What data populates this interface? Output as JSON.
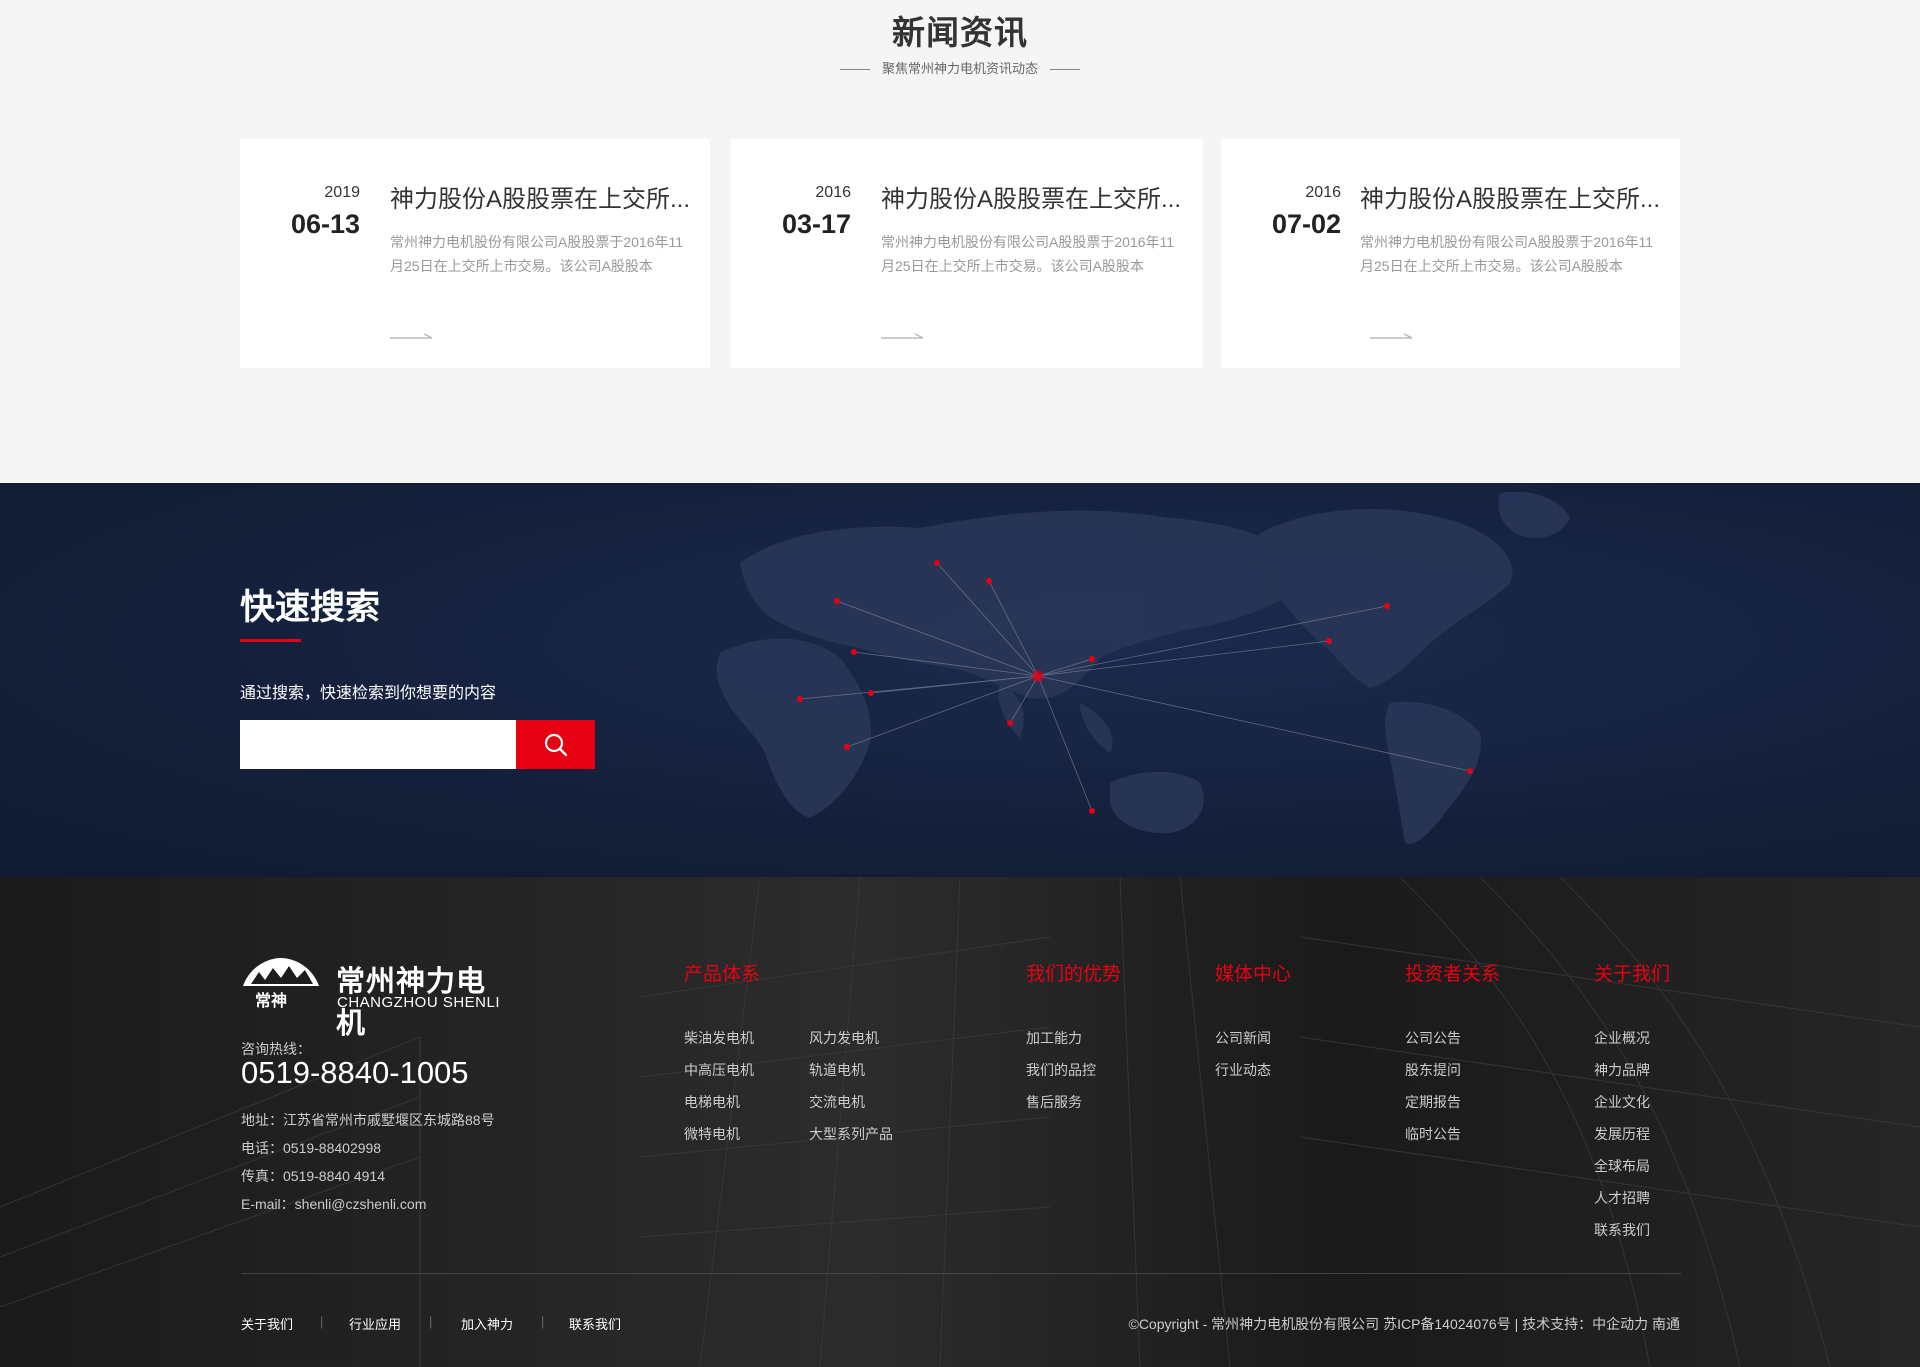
{
  "news": {
    "title": "新闻资讯",
    "subtitle": "聚焦常州神力电机资讯动态",
    "items": [
      {
        "year": "2019",
        "date": "06-13",
        "title": "神力股份A股股票在上交所...",
        "desc": "常州神力电机股份有限公司A股股票于2016年11月25日在上交所上市交易。该公司A股股本"
      },
      {
        "year": "2016",
        "date": "03-17",
        "title": "神力股份A股股票在上交所...",
        "desc": "常州神力电机股份有限公司A股股票于2016年11月25日在上交所上市交易。该公司A股股本"
      },
      {
        "year": "2016",
        "date": "07-02",
        "title": "神力股份A股股票在上交所...",
        "desc": "常州神力电机股份有限公司A股股票于2016年11月25日在上交所上市交易。该公司A股股本"
      }
    ]
  },
  "search": {
    "title": "快速搜索",
    "desc": "通过搜索，快速检索到你想要的内容",
    "placeholder": "",
    "button_icon": "search-icon",
    "accent": "#e60012"
  },
  "footer": {
    "logo": {
      "mark_text": "常神",
      "cn": "常州神力电机",
      "en": "CHANGZHOU SHENLI"
    },
    "hotline_label": "咨询热线：",
    "hotline": "0519-8840-1005",
    "address": "地址：江苏省常州市戚墅堰区东城路88号",
    "phone": "电话：0519-88402998",
    "fax": "传真：0519-8840 4914",
    "email": "E-mail：shenli@czshenli.com",
    "columns": [
      {
        "title": "产品体系",
        "links": [
          "柴油发电机",
          "风力发电机",
          "中高压电机",
          "轨道电机",
          "电梯电机",
          "交流电机",
          "微特电机",
          "大型系列产品"
        ]
      },
      {
        "title": "我们的优势",
        "links": [
          "加工能力",
          "我们的品控",
          "售后服务"
        ]
      },
      {
        "title": "媒体中心",
        "links": [
          "公司新闻",
          "行业动态"
        ]
      },
      {
        "title": "投资者关系",
        "links": [
          "公司公告",
          "股东提问",
          "定期报告",
          "临时公告"
        ]
      },
      {
        "title": "关于我们",
        "links": [
          "企业概况",
          "神力品牌",
          "企业文化",
          "发展历程",
          "全球布局",
          "人才招聘",
          "联系我们"
        ]
      }
    ],
    "bottom_links": [
      "关于我们",
      "行业应用",
      "加入神力",
      "联系我们"
    ],
    "separator": "|",
    "copyright": "©Copyright - 常州神力电机股份有限公司  苏ICP备14024076号  |  技术支持：中企动力  南通"
  },
  "colors": {
    "accent": "#e60012",
    "navy": "#15213d",
    "footer_bg": "#1d1d1d"
  }
}
